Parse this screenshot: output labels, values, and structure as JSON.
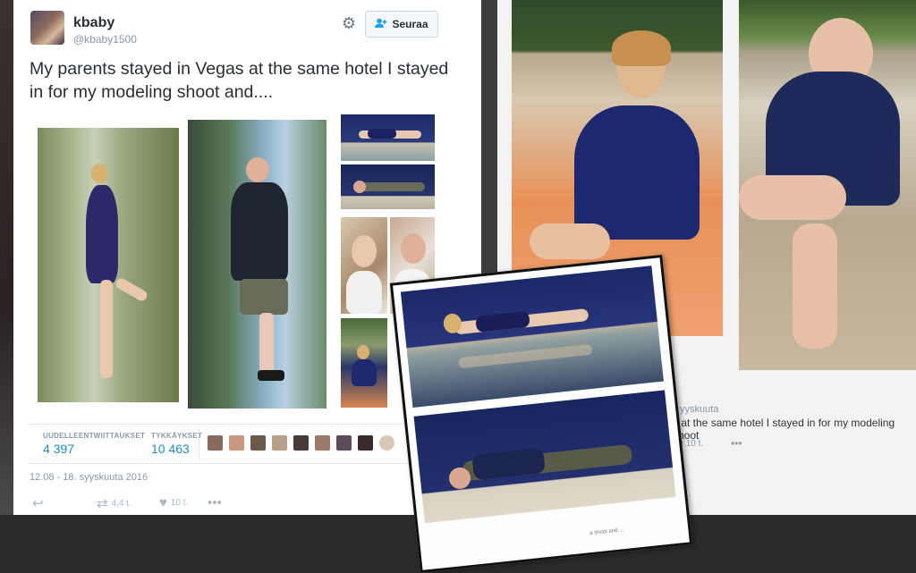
{
  "tweet": {
    "username": "kbaby",
    "handle": "@kbaby1500",
    "follow_label": "Seuraa",
    "text": "My parents stayed in Vegas at the same hotel I stayed in for my modeling shoot and....",
    "stats": {
      "retweets_label": "UUDELLEENTWIITTAUKSET",
      "retweets_value": "4 397",
      "likes_label": "TYKKÄYKSET",
      "likes_value": "10 463"
    },
    "timestamp": "12.08 - 18. syyskuuta 2016",
    "actions": {
      "retweet_count": "4,4 t.",
      "like_count": "10 t."
    },
    "icons": {
      "gear": "gear-icon",
      "follow": "add-person-icon",
      "reply": "reply-icon",
      "retweet": "retweet-icon",
      "like": "heart-icon",
      "more": "more-icon"
    },
    "accent_color": "#1d8fbf"
  },
  "right_panel": {
    "date_fragment": "yyskuuta",
    "text_fragment": "s at the same hotel I stayed in for my modeling shoot",
    "like_count": "10 t."
  },
  "print_overlay": {
    "caption_fragment": "a shoot and...."
  }
}
